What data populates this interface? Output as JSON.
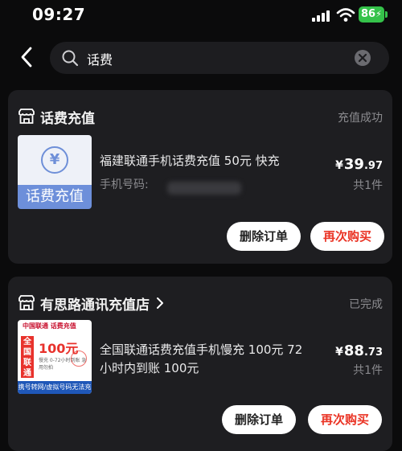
{
  "status_bar": {
    "time": "09:27",
    "battery": "86"
  },
  "search": {
    "query": "话费",
    "back_icon": "chevron-left-icon",
    "search_icon": "magnifier-icon",
    "clear_icon": "clear-circle-icon"
  },
  "orders": [
    {
      "shop_name": "话费充值",
      "status": "充值成功",
      "shop_icon": "shop-icon",
      "thumb_text": "话费充值",
      "thumb_symbol": "¥",
      "title": "福建联通手机话费充值 50元 快充",
      "phone_label": "手机号码:",
      "price_currency": "¥",
      "price_integer": "39",
      "price_decimal": ".97",
      "quantity": "共1件",
      "delete_label": "删除订单",
      "rebuy_label": "再次购买"
    },
    {
      "shop_name": "有思路通讯充值店",
      "status": "已完成",
      "shop_icon": "shop-icon",
      "thumb_brand": "中国联通 话费充值",
      "thumb_side": "全国联通",
      "thumb_amount": "100元",
      "thumb_small": "慢充 0-72小时到账 急用勿拍",
      "thumb_footer": "携号转网/虚拟号码无法充值",
      "title_line1": "全国联通话费充值手机慢充 100元 72",
      "title_line2": "小时内到账 100元",
      "price_currency": "¥",
      "price_integer": "88",
      "price_decimal": ".73",
      "quantity": "共1件",
      "delete_label": "删除订单",
      "rebuy_label": "再次购买"
    }
  ],
  "colors": {
    "background": "#0b0b0c",
    "card": "#1e1e21",
    "accent_red": "#ea3324",
    "battery_green": "#35c24a"
  }
}
